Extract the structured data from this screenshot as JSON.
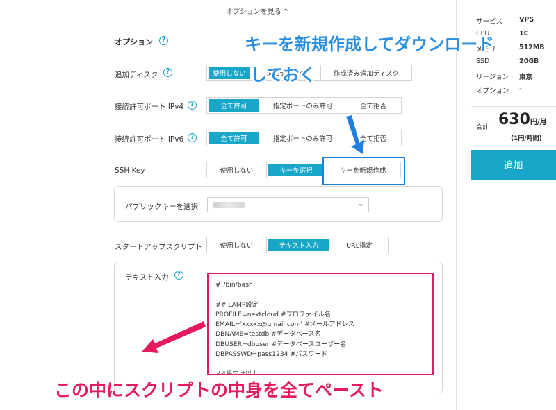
{
  "main": {
    "option_toggle": "オプションを見る",
    "option_title": "オプション",
    "rows": {
      "disk": {
        "label": "追加ディスク",
        "options": [
          "使用しない",
          "追加ディスク",
          "作成済み追加ディスク"
        ],
        "selected": 0
      },
      "ipv4": {
        "label": "接続許可ポート IPv4",
        "options": [
          "全て許可",
          "指定ポートのみ許可",
          "全て拒否"
        ],
        "selected": 0
      },
      "ipv6": {
        "label": "接続許可ポート IPv6",
        "options": [
          "全て許可",
          "指定ポートのみ許可",
          "全て拒否"
        ],
        "selected": 0
      },
      "ssh": {
        "label": "SSH Key",
        "options": [
          "使用しない",
          "キーを選択",
          "キーを新規作成"
        ],
        "selected": 1
      },
      "startup": {
        "label": "スタートアップスクリプト",
        "options": [
          "使用しない",
          "テキスト入力",
          "URL指定"
        ],
        "selected": 1
      }
    },
    "public_key_label": "パブリックキーを選択",
    "text_input_label": "テキスト入力",
    "script_lines": [
      "#!/bin/bash",
      "",
      "## LAMP設定",
      "PROFILE=nextcloud #プロファイル名",
      "EMAIL='xxxxx@gmail.com' #メールアドレス",
      "DBNAME=testdb #データベース名",
      "DBUSER=dbuser #データベースユーザー名",
      "DBPASSWD=pass1234 #パスワード",
      "",
      "##設定は以上"
    ]
  },
  "summary": {
    "specs": [
      {
        "key": "サービス",
        "value": "VPS"
      },
      {
        "key": "CPU",
        "value": "1C"
      },
      {
        "key": "メモリ",
        "value": "512MB"
      },
      {
        "key": "SSD",
        "value": "20GB"
      },
      {
        "key": "リージョン",
        "value": "東京"
      },
      {
        "key": "オプション",
        "value": "-"
      }
    ],
    "total_label": "合計",
    "price": "630",
    "price_unit": "円/月",
    "price_sub": "(1円/時間)",
    "add_button": "追加"
  },
  "annotations": {
    "blue_line1": "キーを新規作成してダウンロード",
    "blue_line2": "しておく",
    "pink": "この中にスクリプトの中身を全てペースト"
  },
  "colors": {
    "accent": "#19a7c9",
    "annotation_blue": "#2a8fe0",
    "annotation_pink": "#e5195f"
  }
}
